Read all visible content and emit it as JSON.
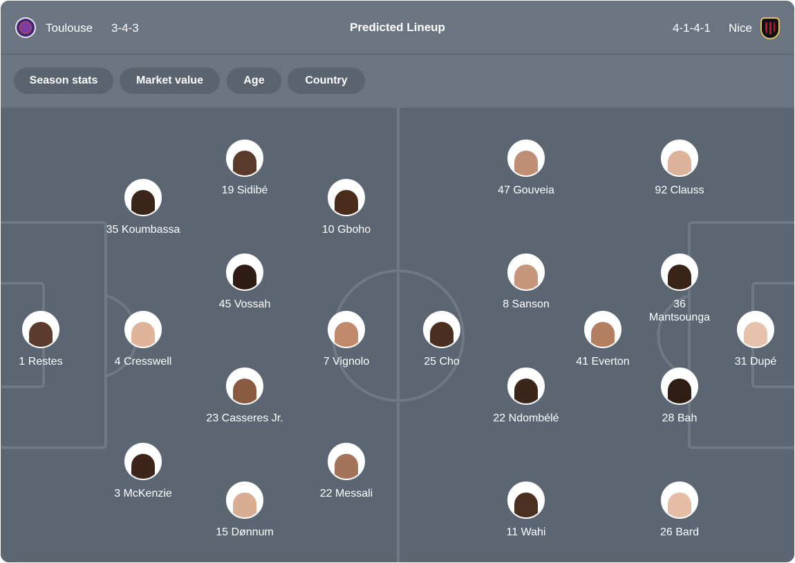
{
  "header": {
    "home_team": "Toulouse",
    "home_formation": "3-4-3",
    "title": "Predicted Lineup",
    "away_formation": "4-1-4-1",
    "away_team": "Nice"
  },
  "filters": [
    "Season stats",
    "Market value",
    "Age",
    "Country"
  ],
  "colors": {
    "header_bg": "#6b7581",
    "pitch_bg": "#5c6672",
    "chip_bg": "#5a636e",
    "line": "#6f7984",
    "text": "#ffffff"
  },
  "home_players": [
    {
      "label": "19 Sidibé",
      "skin": "#5a3a2a"
    },
    {
      "label": "35 Koumbassa",
      "skin": "#3b2418"
    },
    {
      "label": "10 Gboho",
      "skin": "#4a2c1c"
    },
    {
      "label": "45 Vossah",
      "skin": "#2e1c14"
    },
    {
      "label": "1 Restes",
      "skin": "#5b3b2b"
    },
    {
      "label": "4 Cresswell",
      "skin": "#e0b49a"
    },
    {
      "label": "7 Vignolo",
      "skin": "#c08a6a"
    },
    {
      "label": "23 Casseres Jr.",
      "skin": "#8a5a40"
    },
    {
      "label": "3 McKenzie",
      "skin": "#3d2519"
    },
    {
      "label": "22 Messali",
      "skin": "#a4735a"
    },
    {
      "label": "15 Dønnum",
      "skin": "#d8ad92"
    }
  ],
  "away_players": [
    {
      "label": "47 Gouveia",
      "skin": "#c08e74"
    },
    {
      "label": "92 Clauss",
      "skin": "#dcb39a"
    },
    {
      "label": "8 Sanson",
      "skin": "#c6957a"
    },
    {
      "label": "36 Mantsounga",
      "skin": "#3a2418"
    },
    {
      "label": "25 Cho",
      "skin": "#4a2e20"
    },
    {
      "label": "41 Everton",
      "skin": "#b47e60"
    },
    {
      "label": "31 Dupé",
      "skin": "#e6c2ac"
    },
    {
      "label": "22 Ndombélé",
      "skin": "#3c2519"
    },
    {
      "label": "28 Bah",
      "skin": "#2f1d15"
    },
    {
      "label": "11 Wahi",
      "skin": "#4b2f21"
    },
    {
      "label": "26 Bard",
      "skin": "#e5bca5"
    }
  ]
}
